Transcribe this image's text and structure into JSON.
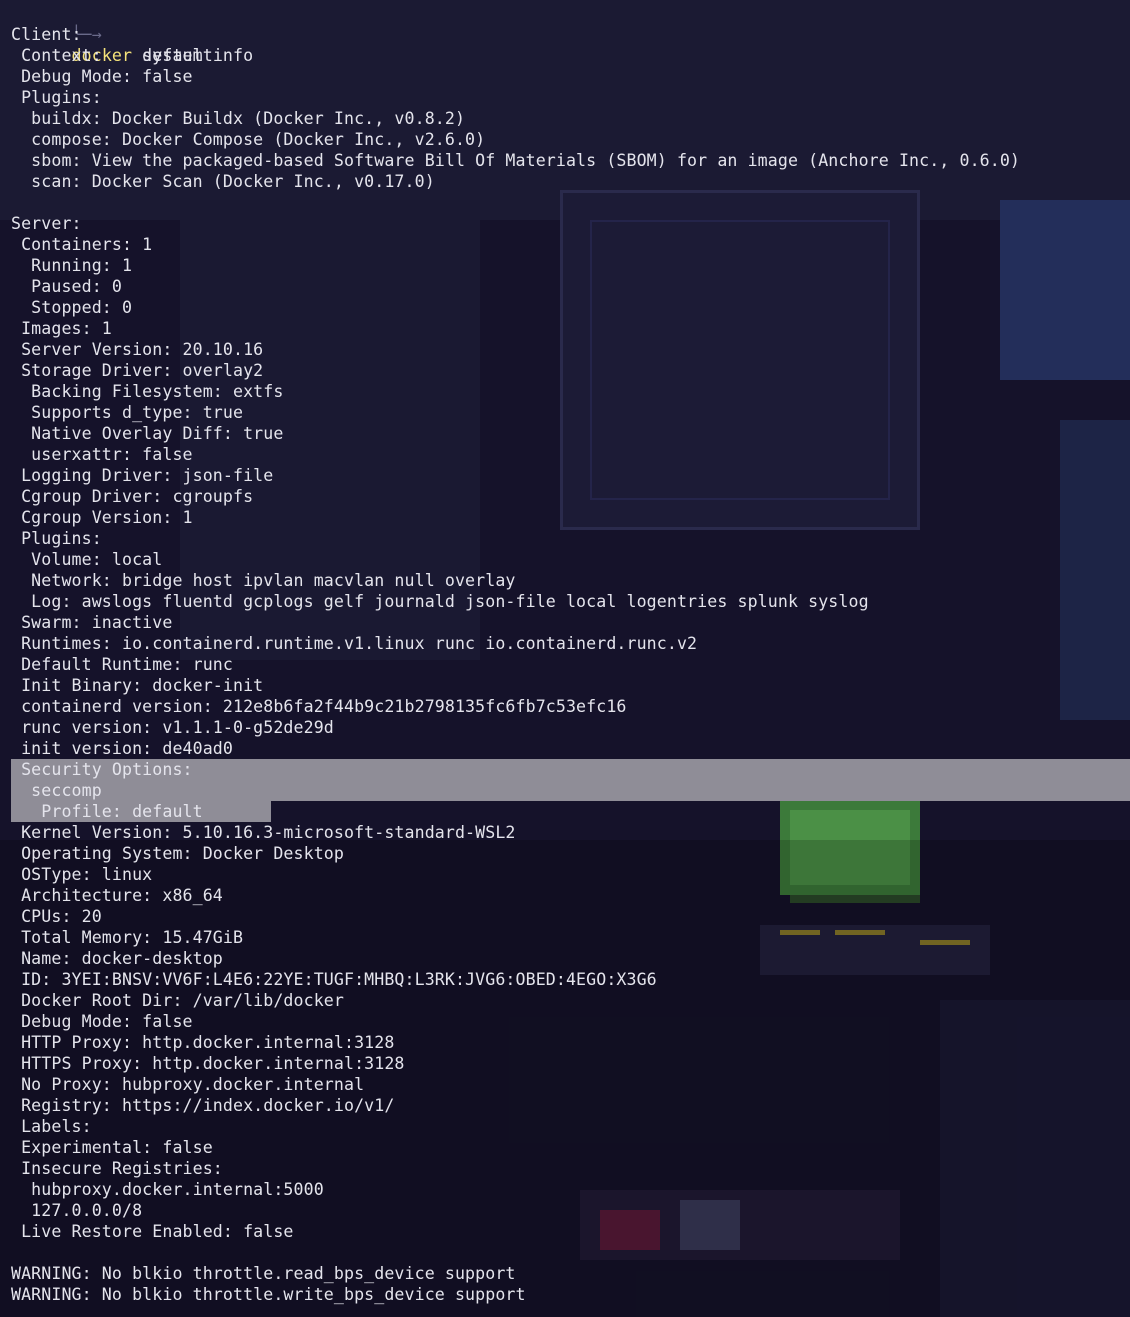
{
  "prompt": {
    "arrow": "╰─→",
    "command_name": "docker",
    "command_args": " system info"
  },
  "colors": {
    "background": "#15122a",
    "text": "#e4e4ec",
    "command": "#f4e27a",
    "selection": "#8f8d97"
  },
  "output": [
    "Client:",
    " Context:    default",
    " Debug Mode: false",
    " Plugins:",
    "  buildx: Docker Buildx (Docker Inc., v0.8.2)",
    "  compose: Docker Compose (Docker Inc., v2.6.0)",
    "  sbom: View the packaged-based Software Bill Of Materials (SBOM) for an image (Anchore Inc., 0.6.0)",
    "  scan: Docker Scan (Docker Inc., v0.17.0)",
    "",
    "Server:",
    " Containers: 1",
    "  Running: 1",
    "  Paused: 0",
    "  Stopped: 0",
    " Images: 1",
    " Server Version: 20.10.16",
    " Storage Driver: overlay2",
    "  Backing Filesystem: extfs",
    "  Supports d_type: true",
    "  Native Overlay Diff: true",
    "  userxattr: false",
    " Logging Driver: json-file",
    " Cgroup Driver: cgroupfs",
    " Cgroup Version: 1",
    " Plugins:",
    "  Volume: local",
    "  Network: bridge host ipvlan macvlan null overlay",
    "  Log: awslogs fluentd gcplogs gelf journald json-file local logentries splunk syslog",
    " Swarm: inactive",
    " Runtimes: io.containerd.runtime.v1.linux runc io.containerd.runc.v2",
    " Default Runtime: runc",
    " Init Binary: docker-init",
    " containerd version: 212e8b6fa2f44b9c21b2798135fc6fb7c53efc16",
    " runc version: v1.1.1-0-g52de29d",
    " init version: de40ad0",
    " Security Options:",
    "  seccomp",
    "   Profile: default",
    " Kernel Version: 5.10.16.3-microsoft-standard-WSL2",
    " Operating System: Docker Desktop",
    " OSType: linux",
    " Architecture: x86_64",
    " CPUs: 20",
    " Total Memory: 15.47GiB",
    " Name: docker-desktop",
    " ID: 3YEI:BNSV:VV6F:L4E6:22YE:TUGF:MHBQ:L3RK:JVG6:OBED:4EGO:X3G6",
    " Docker Root Dir: /var/lib/docker",
    " Debug Mode: false",
    " HTTP Proxy: http.docker.internal:3128",
    " HTTPS Proxy: http.docker.internal:3128",
    " No Proxy: hubproxy.docker.internal",
    " Registry: https://index.docker.io/v1/",
    " Labels:",
    " Experimental: false",
    " Insecure Registries:",
    "  hubproxy.docker.internal:5000",
    "  127.0.0.0/8",
    " Live Restore Enabled: false",
    "",
    "WARNING: No blkio throttle.read_bps_device support",
    "WARNING: No blkio throttle.write_bps_device support"
  ]
}
